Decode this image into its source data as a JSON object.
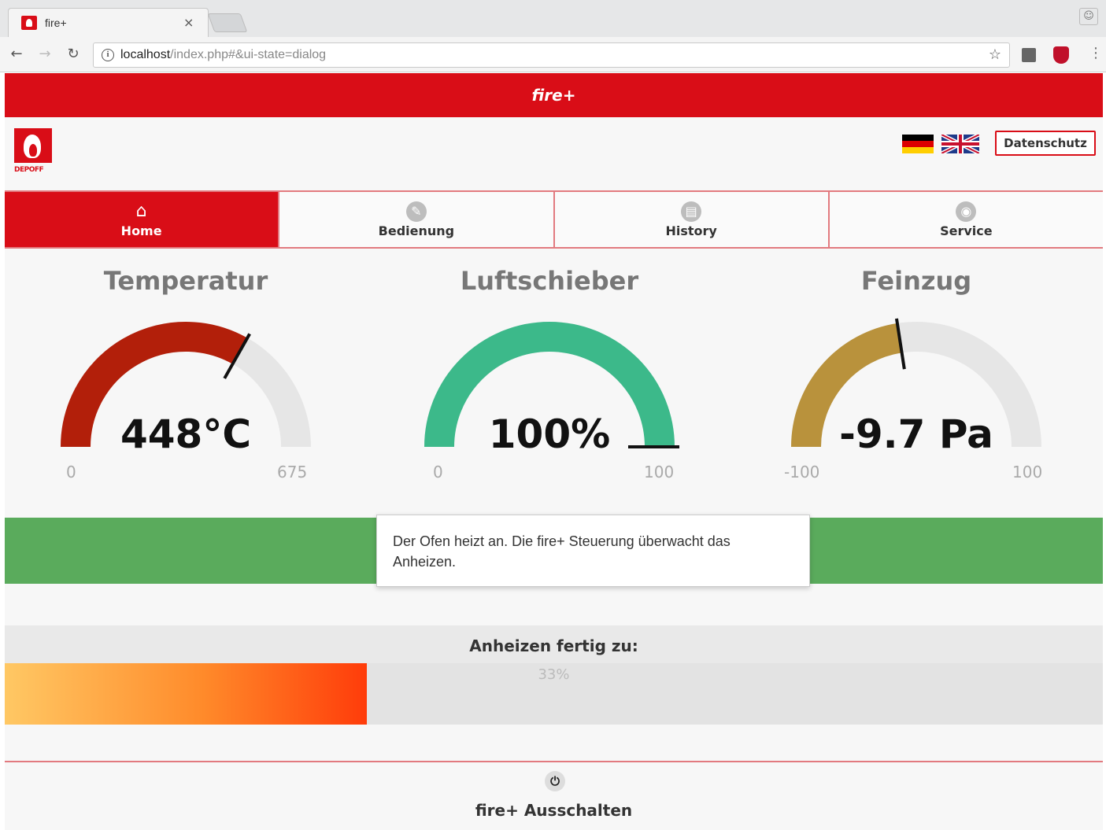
{
  "browser": {
    "tab_title": "fire+",
    "tab_close": "×",
    "url_host": "localhost",
    "url_path": "/index.php#&ui-state=dialog"
  },
  "app": {
    "header_title": "fire+",
    "logo_text": "DEPOFF",
    "datenschutz_label": "Datenschutz",
    "brand_color": "#d90d17"
  },
  "nav": {
    "tabs": [
      {
        "label": "Home",
        "icon": "home-icon",
        "active": true
      },
      {
        "label": "Bedienung",
        "icon": "pencil-icon",
        "active": false
      },
      {
        "label": "History",
        "icon": "history-icon",
        "active": false
      },
      {
        "label": "Service",
        "icon": "service-icon",
        "active": false
      }
    ]
  },
  "gauges": [
    {
      "title": "Temperatur",
      "value_text": "448°C",
      "value": 448,
      "min": 0,
      "max": 675,
      "min_label": "0",
      "max_label": "675",
      "color": "#b21f0a"
    },
    {
      "title": "Luftschieber",
      "value_text": "100%",
      "value": 100,
      "min": 0,
      "max": 100,
      "min_label": "0",
      "max_label": "100",
      "color": "#3cb98a"
    },
    {
      "title": "Feinzug",
      "value_text": "-9.7 Pa",
      "value": -9.7,
      "min": -100,
      "max": 100,
      "min_label": "-100",
      "max_label": "100",
      "color": "#b9923c"
    }
  ],
  "status": {
    "message": "Der Ofen heizt an. Die fire+ Steuerung überwacht das Anheizen.",
    "color": "#5aab5c"
  },
  "progress": {
    "heading": "Anheizen fertig zu:",
    "percent_text": "33%",
    "fraction": 0.33
  },
  "power": {
    "label": "fire+ Ausschalten"
  }
}
